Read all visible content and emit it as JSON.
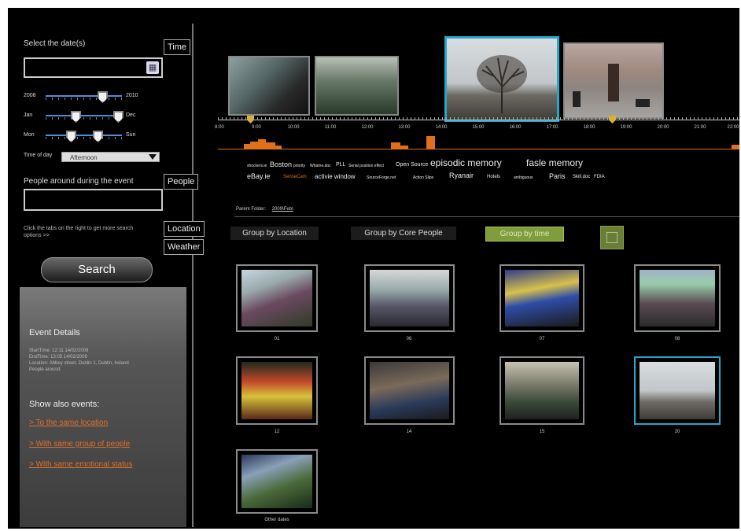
{
  "search": {
    "date_label": "Select the date(s)",
    "year_from": "2008",
    "year_to": "2010",
    "month_from": "Jan",
    "month_to": "Dec",
    "day_from": "Mon",
    "day_to": "Sun",
    "time_of_day_label": "Time of day",
    "time_of_day_value": "Afternoon",
    "people_label": "People around during the event",
    "hint": "Click the tabs on the right to get more search options >>",
    "search_button": "Search"
  },
  "tabs": {
    "time": "Time",
    "people": "People",
    "location": "Location",
    "weather": "Weather"
  },
  "details": {
    "title": "Event Details",
    "start": "StartTime: 12:11 14/02/2009",
    "end": "EndTime: 13:05 14/02/2009",
    "location": "Location: Abbey street, Dublin 1, Dublin, Ireland",
    "people": "People around:",
    "show_also": "Show also events:",
    "links": [
      "> To the same location",
      "> With same group of people",
      "> With same emotional status"
    ]
  },
  "timeline": {
    "labels": [
      "8:00",
      "9:00",
      "10:00",
      "11:00",
      "12:00",
      "13:00",
      "14:00",
      "15:00",
      "16:00",
      "17:00",
      "18:00",
      "19:00",
      "20:00",
      "21:00",
      "22:00"
    ]
  },
  "tags": [
    "shockers.ie",
    "Boston",
    "priority",
    "Whame.doc",
    "PLL",
    "Serial position effect",
    "Open Source",
    "episodic memory",
    "fasle memory",
    "eBay.ie",
    "SenseCam",
    "activie window",
    "SourceForge.net",
    "Action Slips",
    "Ryanair",
    "Hotels",
    "ambiguous",
    "Paris",
    "Skill.doc",
    "FDIA"
  ],
  "folder": {
    "label": "Parent Folder:",
    "value": "2009\\Feb\\"
  },
  "groups": {
    "by_location": "Group by Location",
    "by_people": "Group by Core People",
    "by_time": "Group by time"
  },
  "grid_captions": [
    "01",
    "06",
    "07",
    "08",
    "12",
    "14",
    "15",
    "20",
    "Other dates"
  ],
  "colors": {
    "accent": "#29a7c9",
    "orange": "#e0701a",
    "active_group": "#7f9d3b"
  }
}
